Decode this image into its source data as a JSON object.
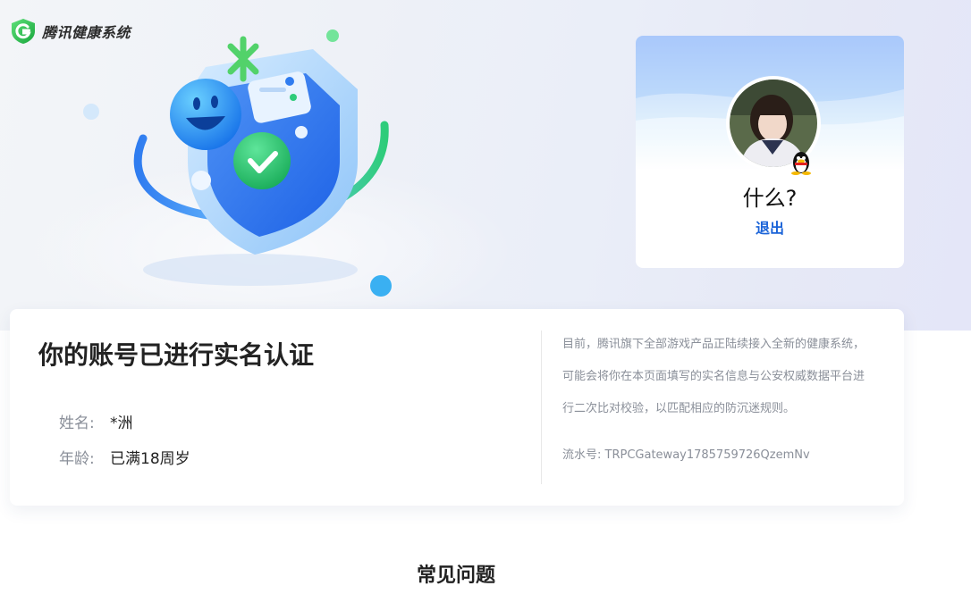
{
  "header": {
    "logo_text": "腾讯健康系统"
  },
  "profile": {
    "nickname": "什么?",
    "logout_label": "退出"
  },
  "verification": {
    "title": "你的账号已进行实名认证",
    "name_label": "姓名:",
    "name_value": "*洲",
    "age_label": "年龄:",
    "age_value": "已满18周岁",
    "notice": "目前，腾讯旗下全部游戏产品正陆续接入全新的健康系统，可能会将你在本页面填写的实名信息与公安权威数据平台进行二次比对校验，以匹配相应的防沉迷规则。",
    "serial_label": "流水号:",
    "serial_value": "TRPCGateway1785759726QzemNv"
  },
  "faq": {
    "title": "常见问题"
  },
  "colors": {
    "brand_green": "#27b84a",
    "link_blue": "#1a63d8",
    "muted_text": "#8a8f99"
  }
}
